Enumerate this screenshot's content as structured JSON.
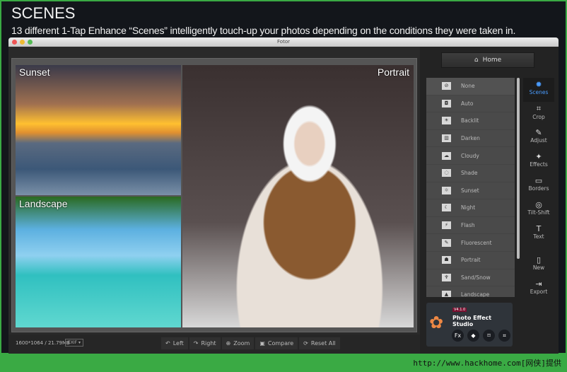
{
  "header": {
    "title": "SCENES",
    "subtitle": "13 different 1-Tap Enhance “Scenes” intelligently touch-up your photos depending on the conditions they were taken in."
  },
  "window": {
    "title": "Fotor"
  },
  "photos": {
    "sunset": "Sunset",
    "portrait": "Portrait",
    "landscape": "Landscape"
  },
  "bottom": {
    "info": "1600*1064 / 21.79MB",
    "exif": "EXIF ▾",
    "buttons": [
      {
        "label": "Left",
        "icon": "rotate-left-icon",
        "glyph": "↶"
      },
      {
        "label": "Right",
        "icon": "rotate-right-icon",
        "glyph": "↷"
      },
      {
        "label": "Zoom",
        "icon": "zoom-icon",
        "glyph": "⊕"
      },
      {
        "label": "Compare",
        "icon": "compare-icon",
        "glyph": "▣"
      },
      {
        "label": "Reset All",
        "icon": "reset-icon",
        "glyph": "⟳"
      }
    ]
  },
  "panel": {
    "home": "Home",
    "scenes": [
      {
        "label": "None",
        "glyph": "⊘"
      },
      {
        "label": "Auto",
        "glyph": "◘"
      },
      {
        "label": "Backlit",
        "glyph": "☀"
      },
      {
        "label": "Darken",
        "glyph": "▥"
      },
      {
        "label": "Cloudy",
        "glyph": "☁"
      },
      {
        "label": "Shade",
        "glyph": "◌"
      },
      {
        "label": "Sunset",
        "glyph": "☼"
      },
      {
        "label": "Night",
        "glyph": "☾"
      },
      {
        "label": "Flash",
        "glyph": "⚡"
      },
      {
        "label": "Fluorescent",
        "glyph": "✎"
      },
      {
        "label": "Portrait",
        "glyph": "☗"
      },
      {
        "label": "Sand/Snow",
        "glyph": "♆"
      },
      {
        "label": "Landscape",
        "glyph": "▲"
      }
    ],
    "tools": [
      {
        "label": "Scenes",
        "glyph": "✹",
        "active": true
      },
      {
        "label": "Crop",
        "glyph": "⌗"
      },
      {
        "label": "Adjust",
        "glyph": "✎"
      },
      {
        "label": "Effects",
        "glyph": "✦"
      },
      {
        "label": "Borders",
        "glyph": "▭"
      },
      {
        "label": "Tilt-Shift",
        "glyph": "◎"
      },
      {
        "label": "Text",
        "glyph": "T"
      },
      {
        "label": "New",
        "glyph": "▯"
      },
      {
        "label": "Export",
        "glyph": "⇥"
      }
    ],
    "promo": {
      "version": "V4.1.0",
      "name": "Photo Effect Studio",
      "icons": [
        "Fx",
        "◆",
        "⌑",
        "⌗"
      ]
    }
  },
  "footer": "http://www.hackhome.com[网侠]提供",
  "colors": {
    "accent": "#4a9cff",
    "footer_bg": "#3aaa44"
  }
}
